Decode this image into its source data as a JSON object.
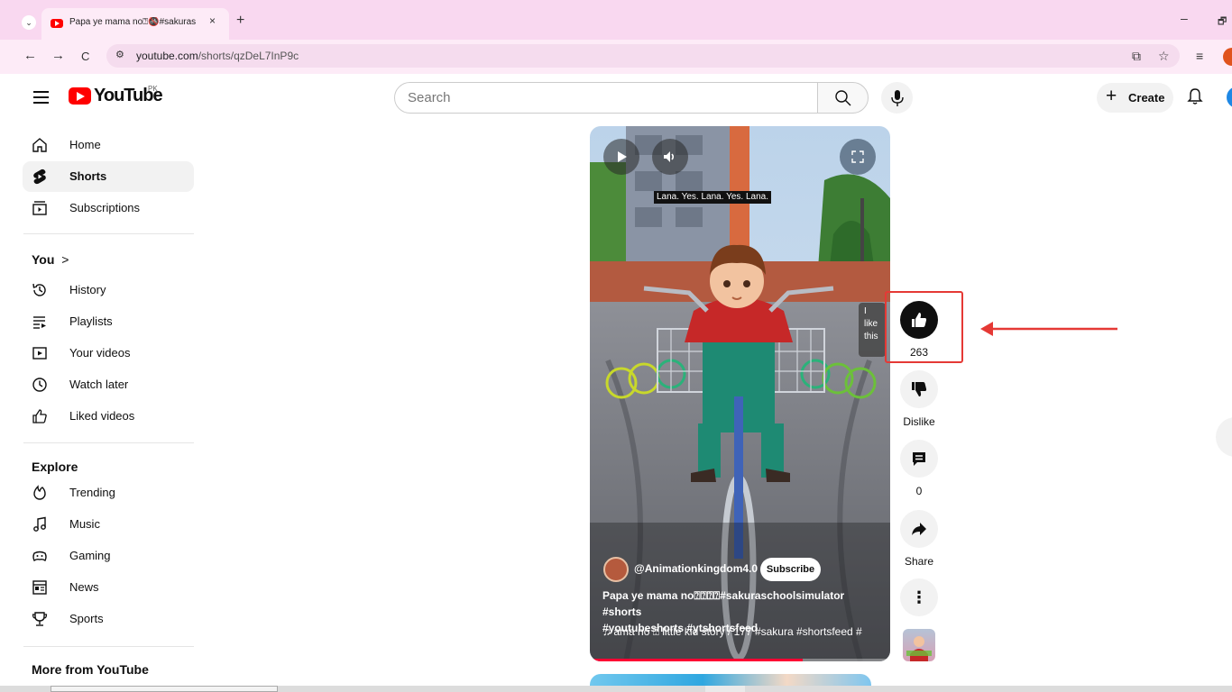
{
  "browser": {
    "tab_title": "Papa ye mama no⍰🚳#sakuras",
    "tab_close": "×",
    "new_tab": "+",
    "url_domain": "youtube.com",
    "url_path": "/shorts/qzDeL7InP9c",
    "back": "←",
    "forward": "→",
    "reload": "C",
    "window_minimize": "–",
    "window_restore": "🗗"
  },
  "masthead": {
    "logo_text": "YouTube",
    "country_code": "PK",
    "search_placeholder": "Search",
    "create_label": "Create"
  },
  "sidebar": {
    "main": [
      {
        "label": "Home",
        "icon": "home-icon"
      },
      {
        "label": "Shorts",
        "icon": "shorts-icon",
        "active": true
      },
      {
        "label": "Subscriptions",
        "icon": "subscriptions-icon"
      }
    ],
    "you_title": "You",
    "you_chevron": ">",
    "you_items": [
      {
        "label": "History",
        "icon": "history-icon"
      },
      {
        "label": "Playlists",
        "icon": "playlists-icon"
      },
      {
        "label": "Your videos",
        "icon": "your-videos-icon"
      },
      {
        "label": "Watch later",
        "icon": "watch-later-icon"
      },
      {
        "label": "Liked videos",
        "icon": "liked-videos-icon"
      }
    ],
    "explore_title": "Explore",
    "explore_items": [
      {
        "label": "Trending",
        "icon": "trending-icon"
      },
      {
        "label": "Music",
        "icon": "music-icon"
      },
      {
        "label": "Gaming",
        "icon": "gaming-icon"
      },
      {
        "label": "News",
        "icon": "news-icon"
      },
      {
        "label": "Sports",
        "icon": "sports-icon"
      }
    ],
    "more_title": "More from YouTube"
  },
  "short": {
    "caption": "Lana. Yes. Lana. Yes. Lana.",
    "like_tooltip": [
      "I",
      "like",
      "this"
    ],
    "channel": "@Animationkingdom4.0",
    "subscribe_label": "Subscribe",
    "description_line1": "Papa ye mama no⍰⍰⍰⍰#sakuraschoolsimulator #shorts",
    "description_line2": "#youtubeshorts #ytshortsfeed",
    "music_note": "♫",
    "music_text": "ama no ⍰ little kid story / 177 #sakura #shortsfeed #",
    "progress_fraction": 0.71
  },
  "actions": {
    "like_count": "263",
    "dislike_label": "Dislike",
    "comment_count": "0",
    "share_label": "Share",
    "more_label": "⋮"
  },
  "colors": {
    "brand_red": "#ff0000",
    "annotation_red": "#e53935",
    "tab_strip": "#f9d8f0"
  }
}
